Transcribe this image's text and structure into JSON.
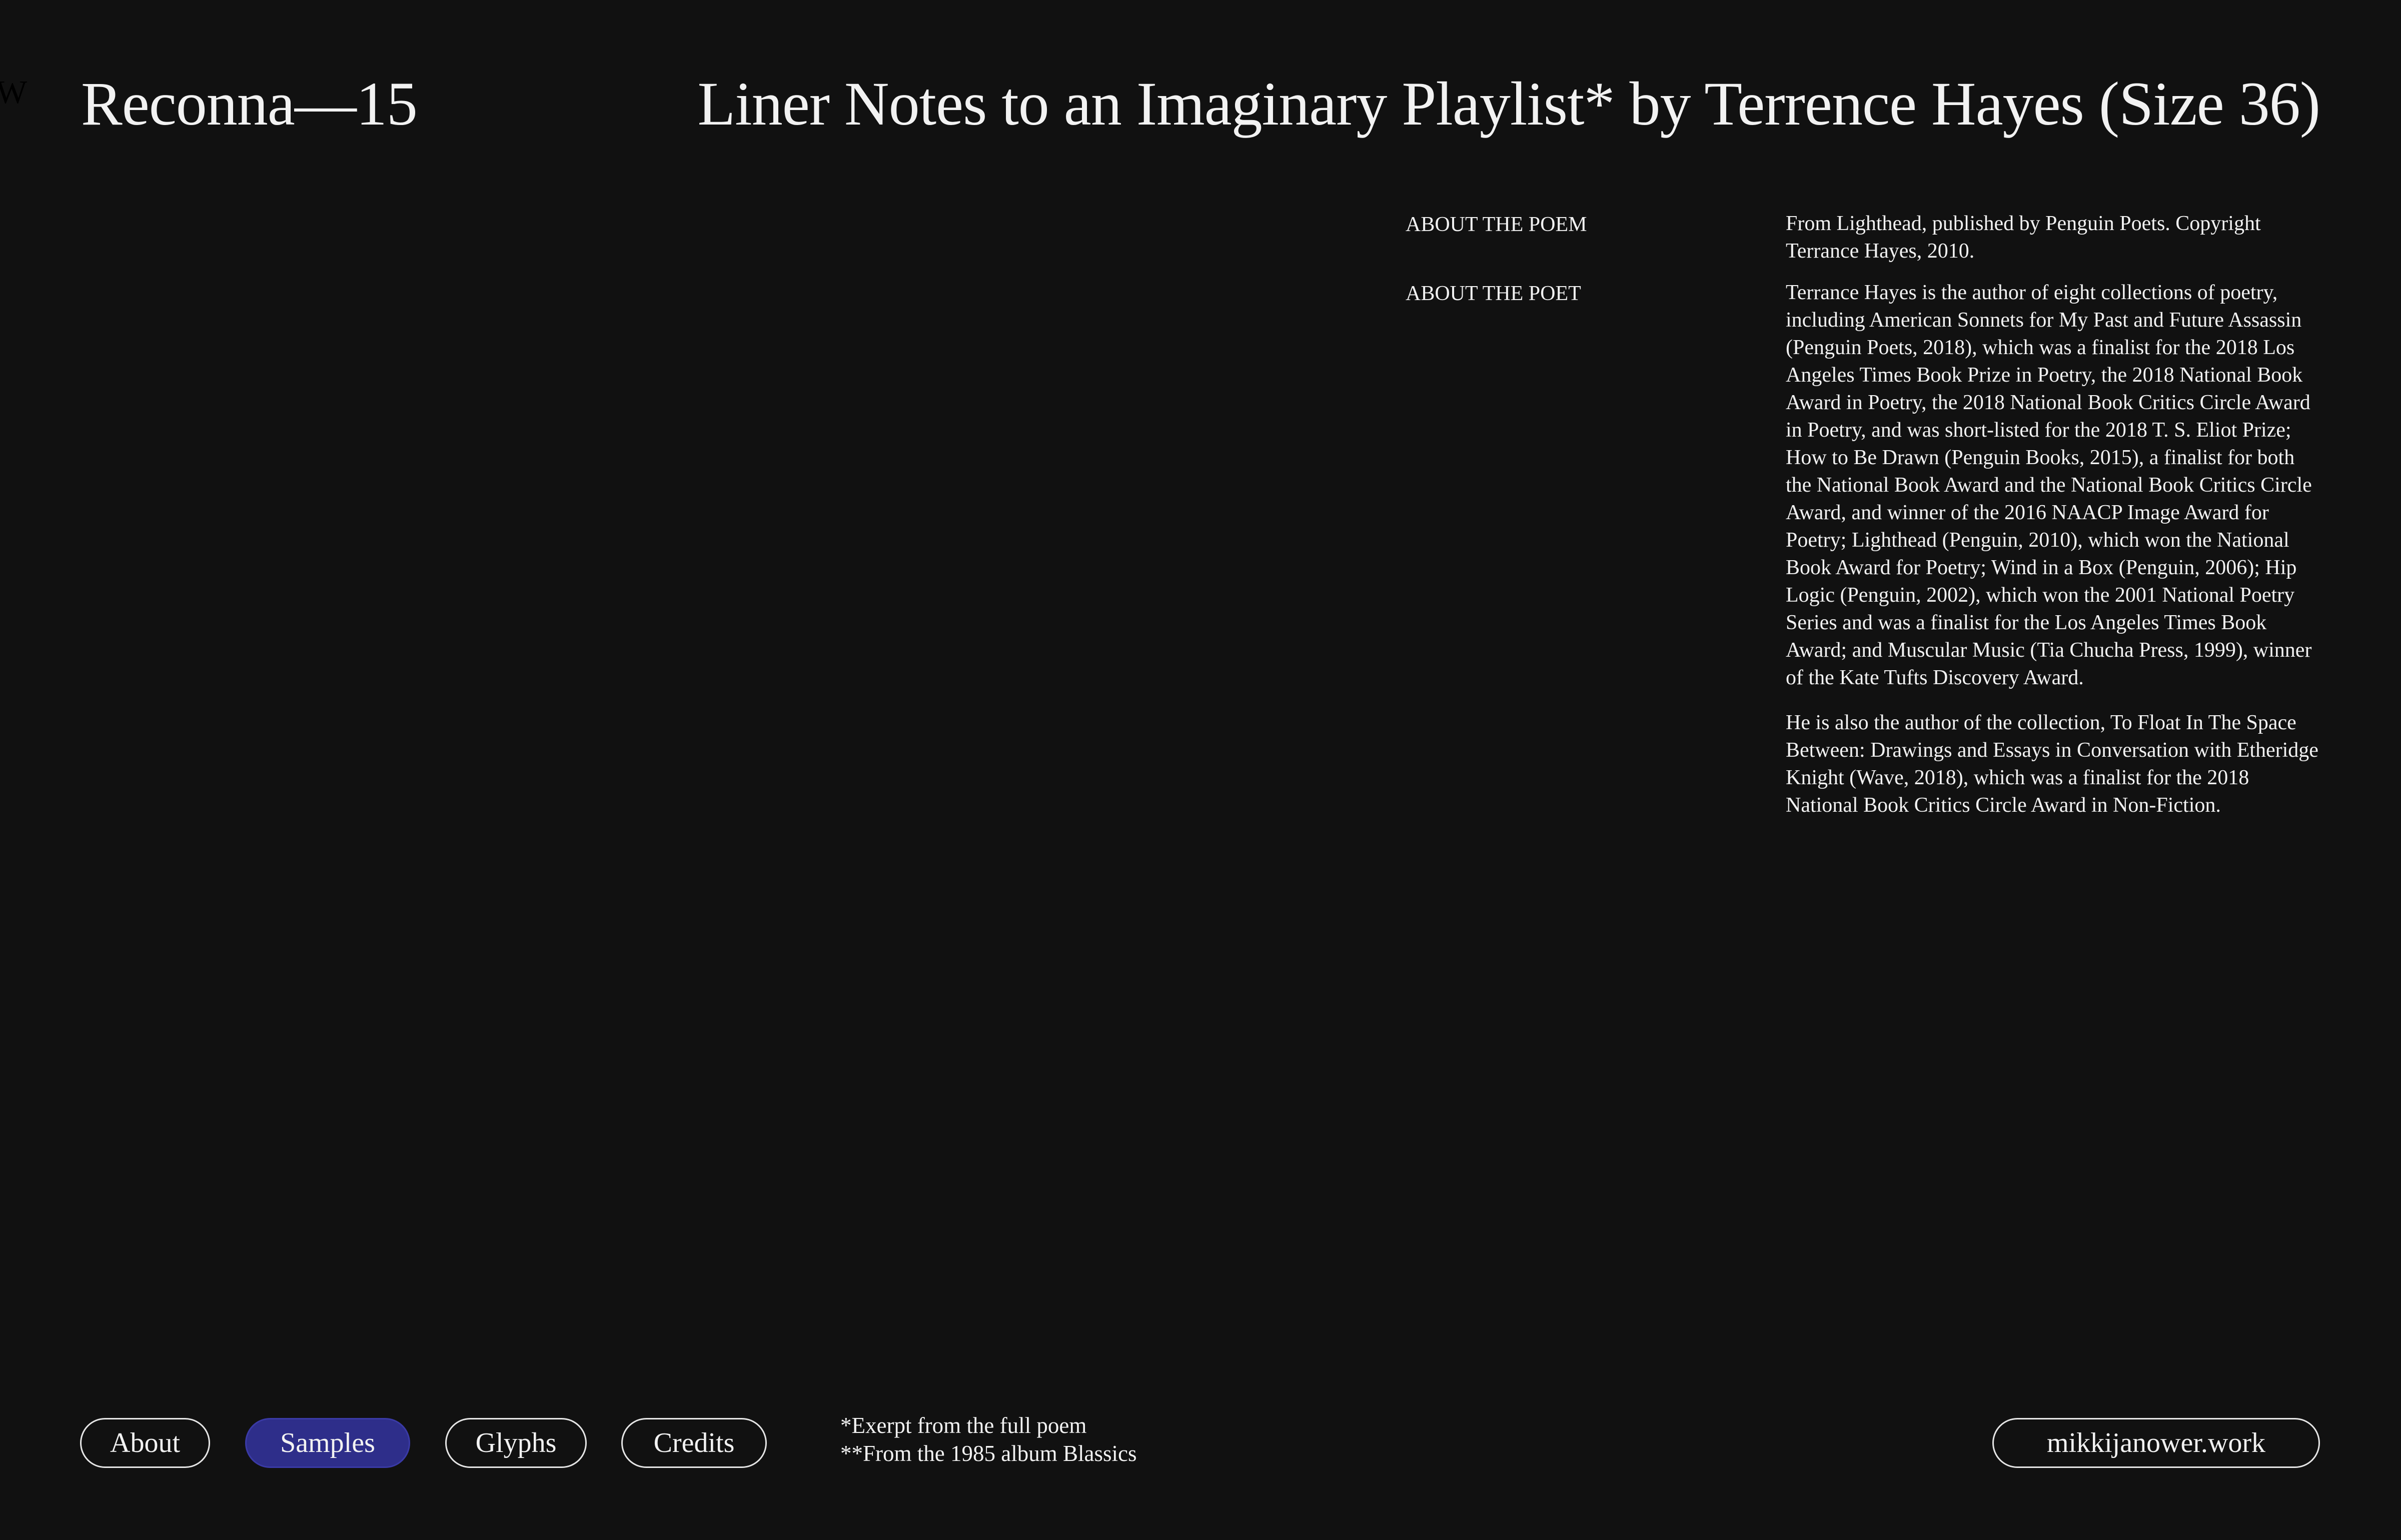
{
  "header": {
    "edge_mark": "W",
    "brand": "Reconna—15",
    "headline": "Liner Notes to an Imaginary Playlist* by Terrence Hayes (Size 36)"
  },
  "info": {
    "poem": {
      "label": "ABOUT THE POEM",
      "paragraphs": [
        "From Lighthead, published by Penguin Poets. Copyright Terrance Hayes, 2010."
      ]
    },
    "poet": {
      "label": "ABOUT THE POET",
      "paragraphs": [
        "Terrance Hayes is the author of eight collections of poetry, including American Sonnets for My Past and Future Assassin (Penguin Poets, 2018), which was a finalist for the 2018 Los Angeles Times Book Prize in Poetry, the 2018 National Book Award in Poetry, the 2018 National Book Critics Circle Award in Poetry, and was short-listed for the 2018 T. S. Eliot Prize; How to Be Drawn (Penguin Books, 2015), a finalist for both the National Book Award and the National Book Critics Circle Award, and winner of the 2016 NAACP Image Award for Poetry; Lighthead (Penguin, 2010), which won the National Book Award for Poetry; Wind in a Box (Penguin, 2006); Hip Logic (Penguin, 2002), which won the 2001 National Poetry Series and was a finalist for the Los Angeles Times Book Award; and Muscular Music (Tia Chucha Press, 1999), winner of the Kate Tufts Discovery Award.",
        "He is also the author of the collection, To Float In The Space Between: Drawings and Essays in Conversation with Etheridge Knight (Wave, 2018), which was a finalist for the 2018 National Book Critics Circle Award in Non-Fiction."
      ]
    }
  },
  "nav": {
    "about": "About",
    "samples": "Samples",
    "glyphs": "Glyphs",
    "credits": "Credits",
    "active": "samples"
  },
  "footnotes": {
    "line1": "*Exerpt from the full poem",
    "line2": "**From the 1985 album Blassics"
  },
  "site_link": "mikkijanower.work",
  "colors": {
    "background": "#111111",
    "text": "#f2f2f2",
    "active_pill": "#2e2e8a"
  }
}
